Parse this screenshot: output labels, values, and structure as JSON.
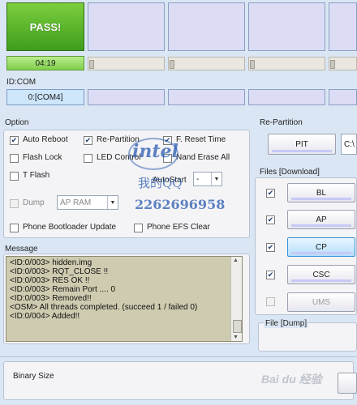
{
  "status": {
    "pass_text": "PASS!",
    "timer": "04:19",
    "progress_percent": 0
  },
  "com": {
    "label": "ID:COM",
    "port": "0:[COM4]"
  },
  "option": {
    "title": "Option",
    "auto_reboot": {
      "label": "Auto Reboot",
      "checked": true
    },
    "re_partition": {
      "label": "Re-Partition",
      "checked": true
    },
    "f_reset_time": {
      "label": "F. Reset Time",
      "checked": true
    },
    "flash_lock": {
      "label": "Flash Lock",
      "checked": false
    },
    "led_control": {
      "label": "LED Control",
      "checked": false
    },
    "nand_erase_all": {
      "label": "Nand Erase All",
      "checked": false
    },
    "t_flash": {
      "label": "T Flash",
      "checked": false
    },
    "autostart_label": "AutoStart",
    "autostart_value": "-",
    "dump": {
      "label": "Dump",
      "checked": false
    },
    "dump_select": "AP RAM",
    "phone_bootloader_update": {
      "label": "Phone Bootloader Update",
      "checked": false
    },
    "phone_efs_clear": {
      "label": "Phone EFS Clear",
      "checked": false
    }
  },
  "repartition": {
    "title": "Re-Partition",
    "pit_label": "PIT",
    "path_prefix": "C:\\"
  },
  "files": {
    "title": "Files [Download]",
    "items": [
      {
        "label": "BL",
        "checked": true
      },
      {
        "label": "AP",
        "checked": true
      },
      {
        "label": "CP",
        "checked": true
      },
      {
        "label": "CSC",
        "checked": true
      },
      {
        "label": "UMS",
        "checked": false
      }
    ]
  },
  "message": {
    "title": "Message",
    "lines": [
      "<ID:0/003> hidden.img",
      "<ID:0/003> RQT_CLOSE !!",
      "<ID:0/003> RES OK !!",
      "<ID:0/003> Remain Port .... 0",
      "<ID:0/003> Removed!!",
      "<OSM> All threads completed. (succeed 1 / failed 0)",
      "<ID:0/004> Added!!"
    ]
  },
  "dump_file": {
    "title": "File [Dump]"
  },
  "binary_size": {
    "label": "Binary Size"
  },
  "watermark": {
    "brand": "intel",
    "sub": "我的QQ",
    "number": "2262696958",
    "site": "Bai du 经验"
  },
  "colors": {
    "pass": "#4aa824",
    "active_button": "#3d8ed1",
    "log_bg": "#cfcbb0"
  }
}
